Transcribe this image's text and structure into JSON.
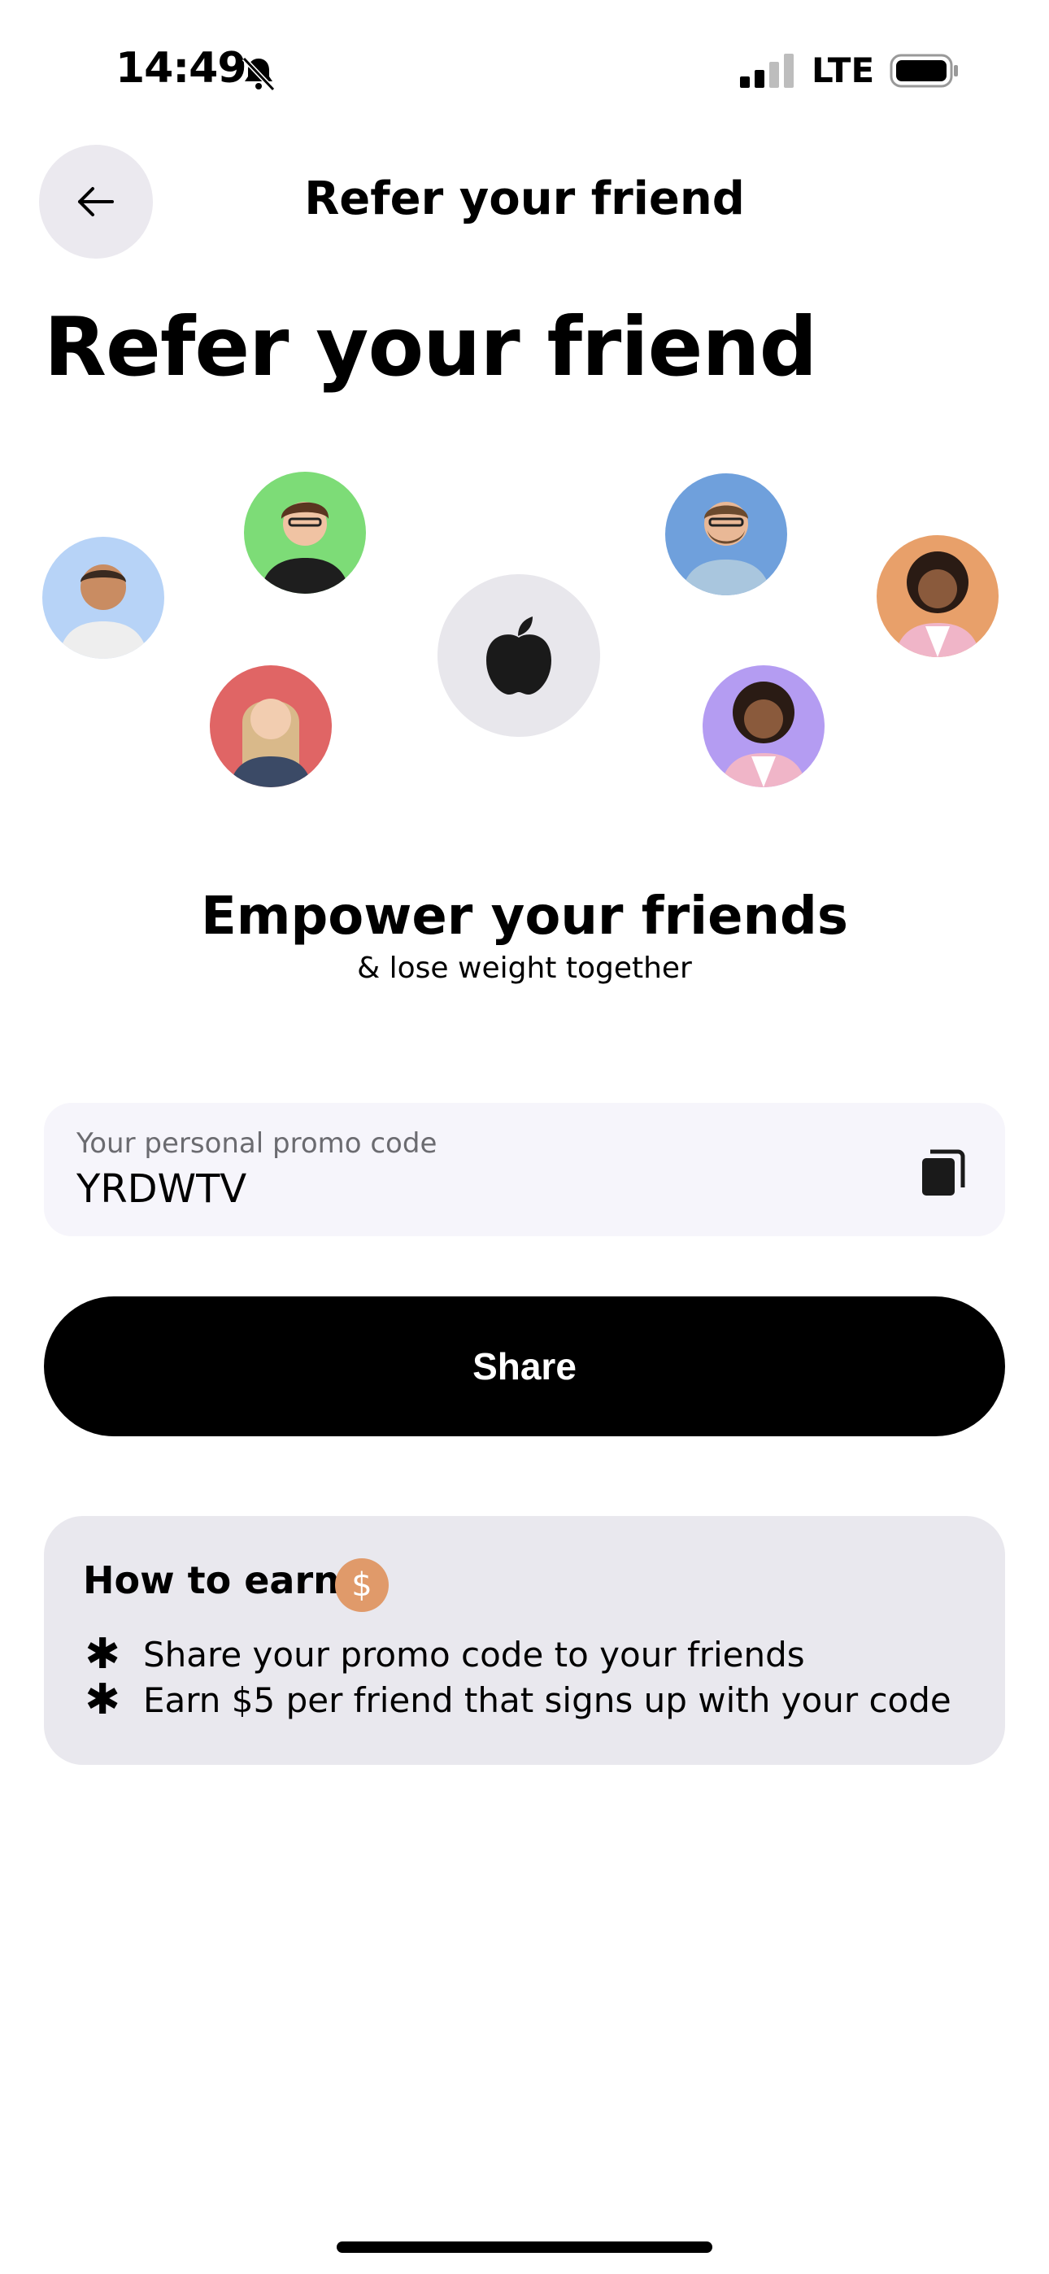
{
  "status_bar": {
    "time": "14:49",
    "network": "LTE",
    "icons": [
      "bell-slash-icon",
      "signal-icon",
      "battery-icon"
    ]
  },
  "nav": {
    "back_icon": "arrow-left-icon",
    "title": "Refer your friend"
  },
  "page_title": "Refer your friend",
  "illustration": {
    "center_icon": "apple-icon",
    "avatar_colors": [
      "#b7d3f7",
      "#7ddc77",
      "#e06565",
      "#6fa0dc",
      "#b49cf2",
      "#e8a06a"
    ]
  },
  "headline": "Empower your friends",
  "subline": "& lose weight together",
  "promo": {
    "label": "Your personal promo code",
    "code": "YRDWTV",
    "copy_icon": "copy-icon"
  },
  "share_label": "Share",
  "earn": {
    "title": "How to earn",
    "coin_symbol": "$",
    "items": [
      "Share your promo code to your friends",
      "Earn $5 per friend that signs up with your code"
    ]
  },
  "colors": {
    "accent_coin": "#e09a6a",
    "card_bg": "#e9e8ee",
    "promo_bg": "#f6f5fb"
  }
}
